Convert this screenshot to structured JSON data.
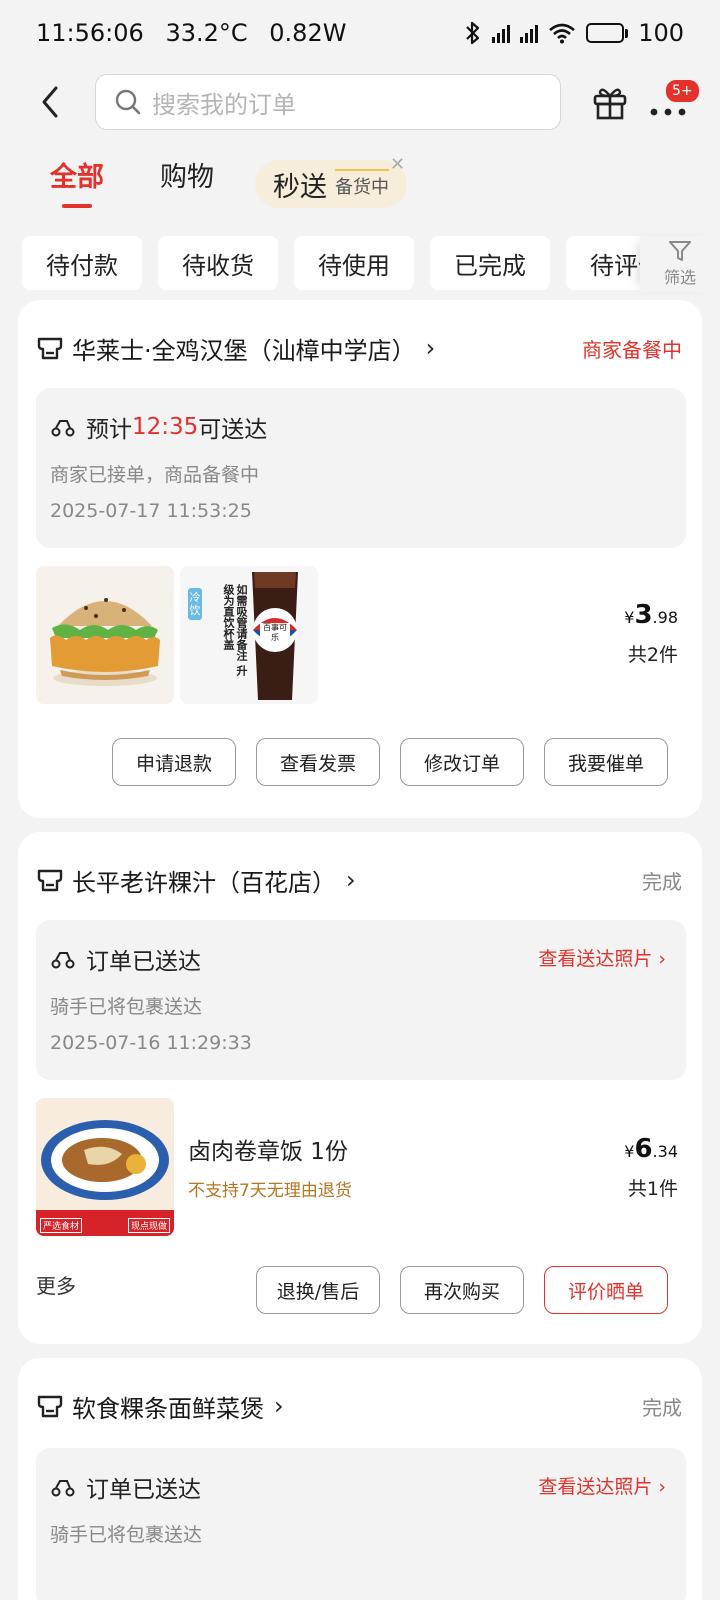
{
  "status_bar": {
    "time": "11:56:06",
    "temperature": "33.2°C",
    "power": "0.82W",
    "battery": "100",
    "battery_level": 1.0,
    "icons": [
      "bluetooth-icon",
      "signal-icon",
      "signal-icon",
      "wifi-icon",
      "battery-icon"
    ]
  },
  "header": {
    "search_placeholder": "搜索我的订单",
    "badge": "5+"
  },
  "tabs": [
    {
      "label": "全部",
      "active": true
    },
    {
      "label": "购物",
      "active": false
    }
  ],
  "flash_tab": {
    "label": "秒送",
    "sub": "备货中"
  },
  "filters": {
    "chips": [
      "待付款",
      "待收货",
      "待使用",
      "已完成",
      "待评价"
    ],
    "filter_label": "筛选"
  },
  "orders": [
    {
      "shop": "华莱士·全鸡汉堡（汕樟中学店）",
      "status": "商家备餐中",
      "eta_prefix": "预计",
      "eta_time": "12:35",
      "eta_suffix": "可送达",
      "desc": "商家已接单，商品备餐中",
      "timestamp": "2025-07-17 11:53:25",
      "price_symbol": "¥",
      "price_int": "3",
      "price_dec": ".98",
      "count": "共2件",
      "drink_label": "冷饮",
      "drink_text": "如需吸管请备注 升级为直饮杯盖",
      "drink_brand": "百事可乐",
      "buttons": [
        "申请退款",
        "查看发票",
        "修改订单",
        "我要催单"
      ]
    },
    {
      "shop": "长平老许粿汁（百花店）",
      "status": "完成",
      "delivered": "订单已送达",
      "photo_link": "查看送达照片",
      "desc": "骑手已将包裹送达",
      "timestamp": "2025-07-16 11:29:33",
      "item_name": "卤肉卷章饭 1份",
      "item_note": "不支持7天无理由退货",
      "image_tag_left": "严选食材",
      "image_tag_right": "现点现做",
      "price_symbol": "¥",
      "price_int": "6",
      "price_dec": ".34",
      "count": "共1件",
      "more": "更多",
      "buttons": [
        "退换/售后",
        "再次购买",
        "评价晒单"
      ]
    },
    {
      "shop": "软食粿条面鲜菜煲",
      "status": "完成",
      "delivered": "订单已送达",
      "photo_link": "查看送达照片",
      "desc": "骑手已将包裹送达"
    }
  ],
  "colors": {
    "accent": "#e3322b",
    "background": "#f3f3f3",
    "card": "#ffffff",
    "flash_bg": "#f7eddb",
    "note": "#b8741f"
  }
}
